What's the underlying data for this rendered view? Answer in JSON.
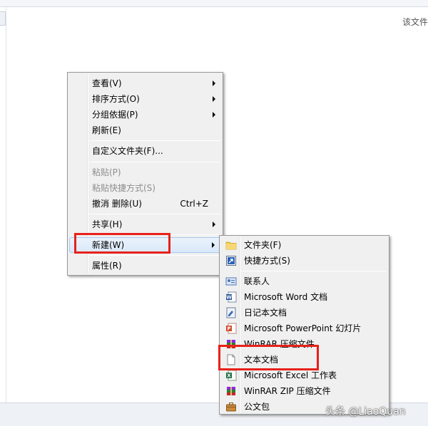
{
  "background": {
    "right_hint": "该文件"
  },
  "context_menu": {
    "items": [
      {
        "label": "查看(V)",
        "submenu": true
      },
      {
        "label": "排序方式(O)",
        "submenu": true
      },
      {
        "label": "分组依据(P)",
        "submenu": true
      },
      {
        "label": "刷新(E)"
      },
      {
        "label": "自定义文件夹(F)..."
      },
      {
        "label": "粘贴(P)",
        "disabled": true
      },
      {
        "label": "粘贴快捷方式(S)",
        "disabled": true
      },
      {
        "label": "撤消 删除(U)",
        "shortcut": "Ctrl+Z"
      },
      {
        "label": "共享(H)",
        "submenu": true
      },
      {
        "label": "新建(W)",
        "submenu": true,
        "highlighted": true
      },
      {
        "label": "属性(R)"
      }
    ]
  },
  "new_submenu": {
    "items": [
      {
        "label": "文件夹(F)",
        "icon": "folder-icon"
      },
      {
        "label": "快捷方式(S)",
        "icon": "shortcut-icon"
      },
      {
        "label": "联系人",
        "icon": "contact-icon"
      },
      {
        "label": "Microsoft Word 文档",
        "icon": "word-icon"
      },
      {
        "label": "日记本文档",
        "icon": "journal-icon"
      },
      {
        "label": "Microsoft PowerPoint 幻灯片",
        "icon": "powerpoint-icon"
      },
      {
        "label": "WinRAR 压缩文件",
        "icon": "winrar-icon"
      },
      {
        "label": "文本文档",
        "icon": "text-document-icon"
      },
      {
        "label": "Microsoft Excel 工作表",
        "icon": "excel-icon"
      },
      {
        "label": "WinRAR ZIP 压缩文件",
        "icon": "winrar-zip-icon"
      },
      {
        "label": "公文包",
        "icon": "briefcase-icon"
      }
    ]
  },
  "watermark": "头条 @LiaoQuan",
  "colors": {
    "highlight_box": "#e8211a",
    "menu_bg": "#f0f0f0"
  }
}
